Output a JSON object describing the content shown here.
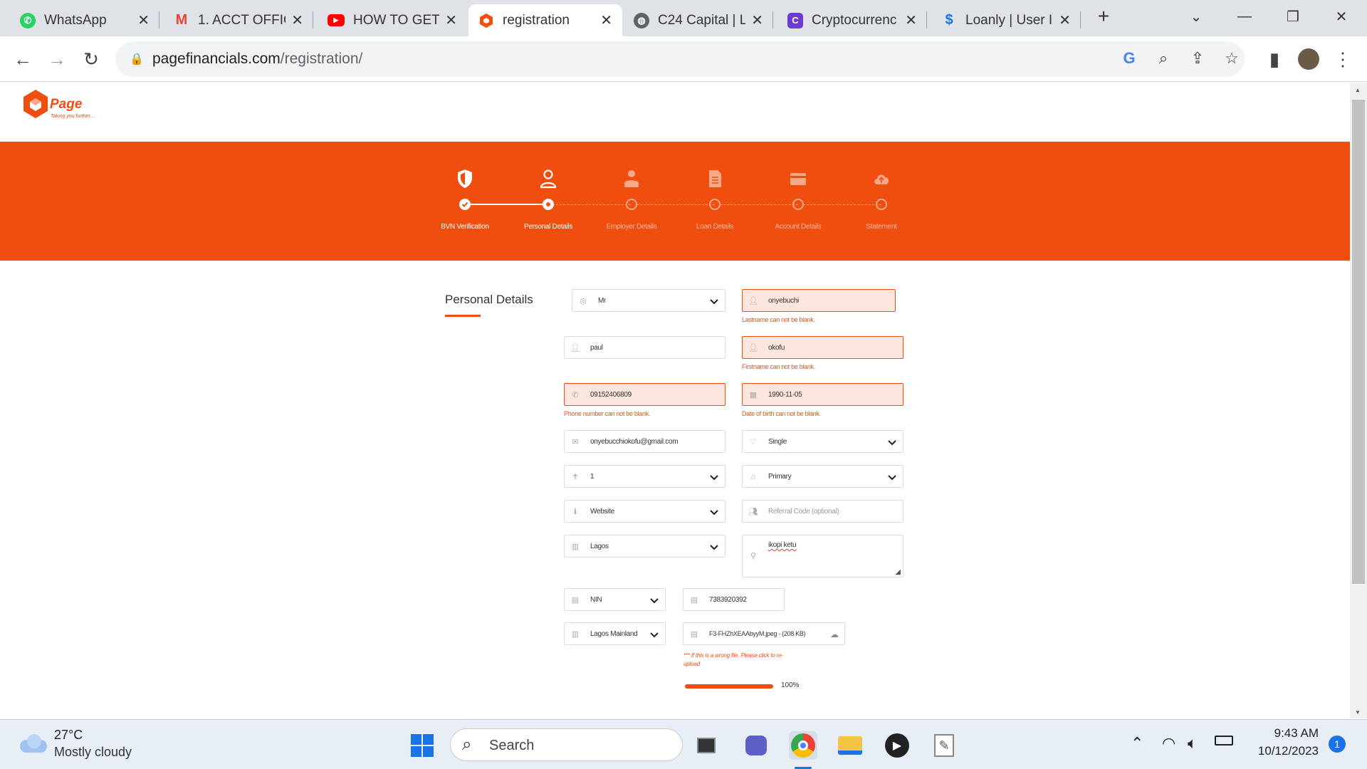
{
  "browser": {
    "tabs": [
      {
        "title": "WhatsApp",
        "icon": "whatsapp-icon",
        "color": "#25d366"
      },
      {
        "title": "1. ACCT OFFIC",
        "icon": "gmail-icon",
        "color": "#ea4335"
      },
      {
        "title": "HOW TO GET",
        "icon": "youtube-icon",
        "color": "#ff0000"
      },
      {
        "title": "registration",
        "icon": "page-favicon-icon",
        "color": "#f04e0f",
        "active": true
      },
      {
        "title": "C24 Capital | L",
        "icon": "globe-icon",
        "color": "#5f6368"
      },
      {
        "title": "Cryptocurrenc",
        "icon": "crypto-icon",
        "color": "#6c3bd1"
      },
      {
        "title": "Loanly | User I",
        "icon": "loanly-icon",
        "color": "#1a73e8"
      }
    ],
    "url_domain": "pagefinancials.com",
    "url_path": "/registration/"
  },
  "brand": {
    "name": "Page",
    "tagline": "Taking you further...",
    "accent": "#f04e0f"
  },
  "steps": [
    {
      "label": "BVN Verification",
      "icon": "shield-icon",
      "state": "done"
    },
    {
      "label": "Personal Details",
      "icon": "user-icon",
      "state": "current"
    },
    {
      "label": "Employer Details",
      "icon": "employer-icon",
      "state": "pending"
    },
    {
      "label": "Loan Details",
      "icon": "document-icon",
      "state": "pending"
    },
    {
      "label": "Account Details",
      "icon": "card-icon",
      "state": "pending"
    },
    {
      "label": "Statement",
      "icon": "cloud-upload-icon",
      "state": "pending"
    }
  ],
  "form": {
    "section_title": "Personal Details",
    "title_value": "Mr",
    "lastname": "onyebuchi",
    "lastname_error": "Lastname can not be blank.",
    "middlename": "paul",
    "firstname": "okofu",
    "firstname_error": "Firstname can not be blank.",
    "phone": "09152406809",
    "phone_error": "Phone number can not be blank.",
    "dob": "1990-11-05",
    "dob_error": "Date of birth can not be blank.",
    "email": "onyebucchiokofu@gmail.com",
    "marital": "Single",
    "dependents": "1",
    "education": "Primary",
    "source": "Website",
    "referral_placeholder": "Referral Code (optional)",
    "state": "Lagos",
    "address": "ikopi ketu",
    "id_type": "NIN",
    "id_number": "7383920392",
    "lga": "Lagos Mainland",
    "file_name": "F3-FHZhXEAAbyyM.jpeg - (208 KB)",
    "file_note": "*** If this is a wrong file. Please click to re-upload",
    "upload_progress": 100,
    "upload_progress_label": "100%"
  },
  "taskbar": {
    "temperature": "27°C",
    "weather": "Mostly cloudy",
    "search_placeholder": "Search",
    "time": "9:43 AM",
    "date": "10/12/2023",
    "notifications": "1"
  }
}
